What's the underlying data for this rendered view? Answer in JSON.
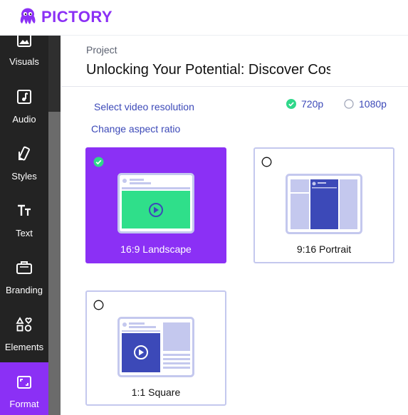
{
  "app": {
    "brand": "PICTORY",
    "brand_color": "#8b30f5"
  },
  "sidebar": {
    "items": [
      {
        "label": "Visuals",
        "icon": "image-icon"
      },
      {
        "label": "Audio",
        "icon": "music-note-icon"
      },
      {
        "label": "Styles",
        "icon": "styles-swatch-icon"
      },
      {
        "label": "Text",
        "icon": "text-icon"
      },
      {
        "label": "Branding",
        "icon": "briefcase-icon"
      },
      {
        "label": "Elements",
        "icon": "shapes-icon"
      },
      {
        "label": "Format",
        "icon": "aspect-ratio-icon",
        "active": true
      }
    ]
  },
  "project": {
    "label": "Project",
    "title": "Unlocking Your Potential: Discover Cost-Effective Online Learning"
  },
  "resolution": {
    "label": "Select video resolution",
    "options": [
      {
        "label": "720p",
        "selected": true
      },
      {
        "label": "1080p",
        "selected": false
      }
    ]
  },
  "aspect": {
    "label": "Change aspect ratio",
    "options": [
      {
        "label": "16:9 Landscape",
        "selected": true
      },
      {
        "label": "9:16 Portrait",
        "selected": false
      },
      {
        "label": "1:1 Square",
        "selected": false
      }
    ]
  },
  "colors": {
    "accent": "#8b30f5",
    "selected_check": "#2fd88a",
    "illustration_blue": "#3c49b8",
    "illustration_light": "#c4c8ee",
    "illustration_green": "#2fdf8a"
  }
}
